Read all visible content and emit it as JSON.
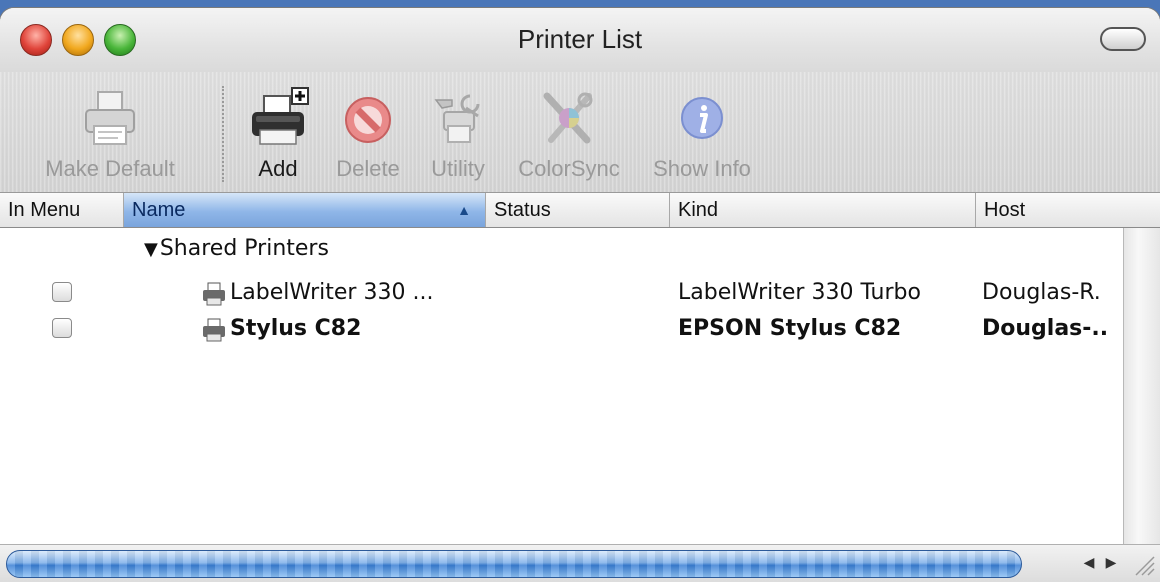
{
  "window": {
    "title": "Printer List"
  },
  "toolbar": {
    "items": [
      {
        "label": "Make Default",
        "icon": "printer-default-icon",
        "enabled": false
      },
      {
        "label": "Add",
        "icon": "add-printer-icon",
        "enabled": true
      },
      {
        "label": "Delete",
        "icon": "delete-icon",
        "enabled": false
      },
      {
        "label": "Utility",
        "icon": "utility-icon",
        "enabled": false
      },
      {
        "label": "ColorSync",
        "icon": "colorsync-icon",
        "enabled": false
      },
      {
        "label": "Show Info",
        "icon": "info-icon",
        "enabled": false
      }
    ]
  },
  "table": {
    "columns": [
      "In Menu",
      "Name",
      "Status",
      "Kind",
      "Host"
    ],
    "sorted_column": "Name",
    "groups": [
      {
        "label": "Shared Printers",
        "expanded": true,
        "rows": [
          {
            "in_menu": false,
            "name": "LabelWriter 330 ...",
            "status": "",
            "kind": "LabelWriter 330 Turbo",
            "host": "Douglas-R.",
            "bold": false
          },
          {
            "in_menu": false,
            "name": "Stylus C82",
            "status": "",
            "kind": "EPSON Stylus C82",
            "host": "Douglas-..",
            "bold": true
          }
        ]
      }
    ]
  },
  "colors": {
    "selection_blue": "#7aa4dc",
    "thumb_blue": "#3a7ed4",
    "close_red": "#e0443a",
    "minimize_yellow": "#f1a81e",
    "zoom_green": "#4ab63a"
  }
}
